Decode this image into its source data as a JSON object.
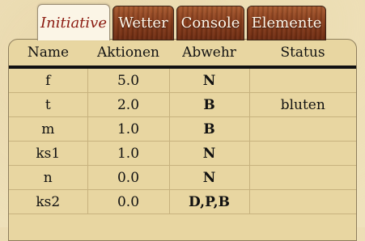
{
  "tabs": [
    {
      "label": "Initiative",
      "active": true
    },
    {
      "label": "Wetter",
      "active": false
    },
    {
      "label": "Console",
      "active": false
    },
    {
      "label": "Elemente",
      "active": false
    }
  ],
  "table": {
    "headers": [
      "Name",
      "Aktionen",
      "Abwehr",
      "Status"
    ],
    "rows": [
      {
        "name": "f",
        "aktionen": "5.0",
        "abwehr": "N",
        "status": ""
      },
      {
        "name": "t",
        "aktionen": "2.0",
        "abwehr": "B",
        "status": "bluten"
      },
      {
        "name": "m",
        "aktionen": "1.0",
        "abwehr": "B",
        "status": ""
      },
      {
        "name": "ks1",
        "aktionen": "1.0",
        "abwehr": "N",
        "status": ""
      },
      {
        "name": "n",
        "aktionen": "0.0",
        "abwehr": "N",
        "status": ""
      },
      {
        "name": "ks2",
        "aktionen": "0.0",
        "abwehr": "D,P,B",
        "status": ""
      }
    ]
  },
  "colors": {
    "active_tab_text": "#8b1a10",
    "panel_background": "#e8d6a1",
    "wood_tab": "#8b3f1d"
  }
}
